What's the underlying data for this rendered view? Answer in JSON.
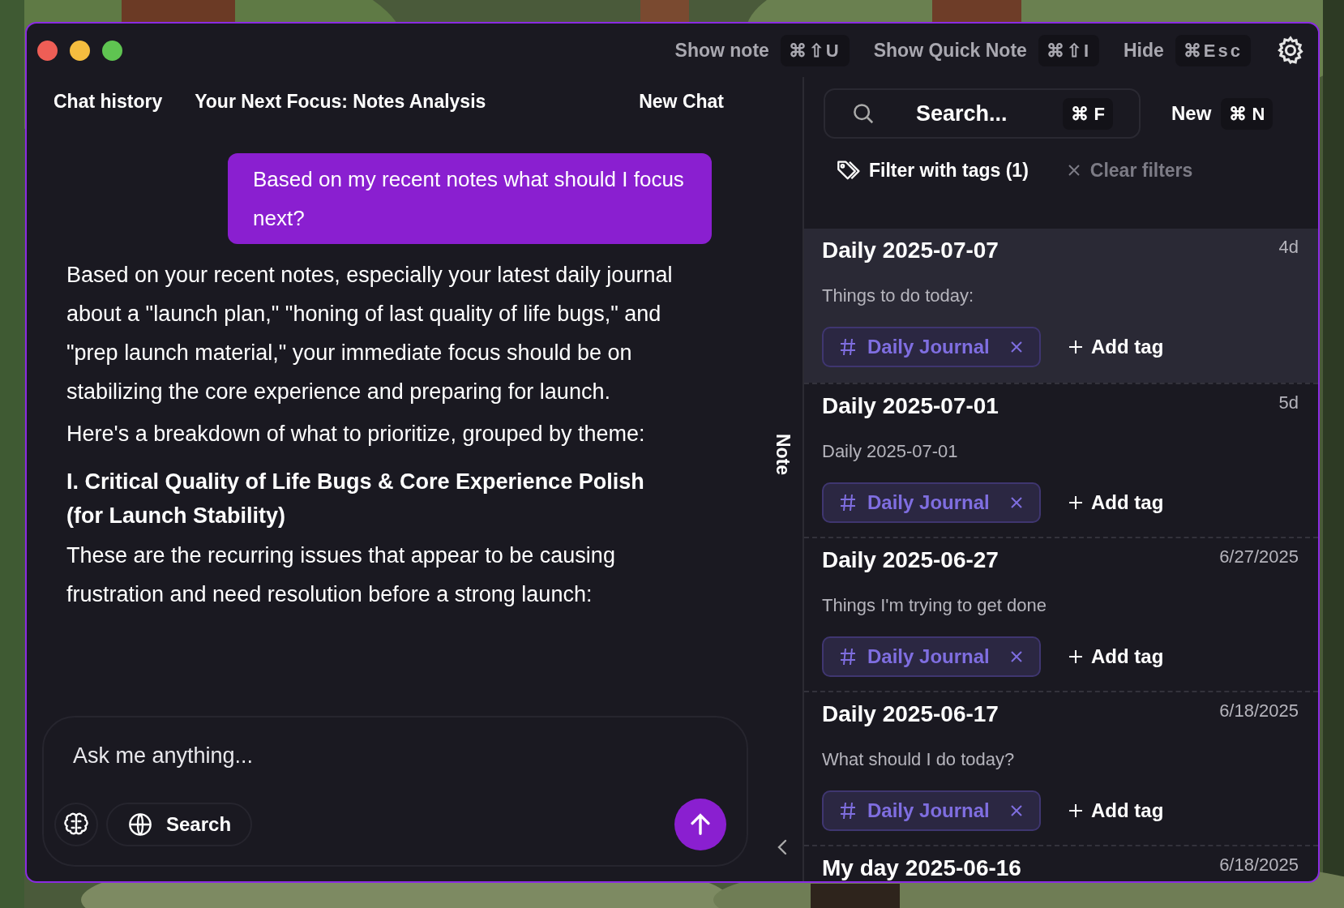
{
  "toolbar": {
    "shortcuts": [
      {
        "label": "Show note",
        "keys": "⌘⇧U"
      },
      {
        "label": "Show Quick Note",
        "keys": "⌘⇧I"
      },
      {
        "label": "Hide",
        "keys": "⌘Esc"
      }
    ]
  },
  "chat": {
    "history_label": "Chat history",
    "title": "Your Next Focus: Notes Analysis",
    "new_chat": "New Chat",
    "messages": [
      {
        "kind": "user",
        "text": "Based on my recent notes what should I focus next?"
      },
      {
        "kind": "assistant",
        "blocks": [
          {
            "kind": "paragraph",
            "text": "Based on your recent notes, especially your latest daily journal about a \"launch plan,\" \"honing of last quality of life bugs,\" and \"prep launch material,\" your immediate focus should be on stabilizing the core experience and preparing for launch."
          },
          {
            "kind": "paragraph",
            "text": "Here's a breakdown of what to prioritize, grouped by theme:"
          },
          {
            "kind": "heading",
            "text": "I. Critical Quality of Life Bugs & Core Experience Polish (for Launch Stability)"
          },
          {
            "kind": "paragraph",
            "text": "These are the recurring issues that appear to be causing frustration and need resolution before a strong launch:"
          }
        ]
      }
    ],
    "input": {
      "placeholder": "Ask me anything...",
      "search_button": "Search"
    }
  },
  "side_tab": "Note",
  "notes": {
    "search": {
      "placeholder": "Search...",
      "keys": "⌘ F"
    },
    "new_button": "New",
    "new_keys": "⌘ N",
    "filter": "Filter with tags (1)",
    "clear": "Clear filters",
    "items": [
      {
        "title": "Daily 2025-07-07",
        "time": "4d",
        "preview": "Things to do today:",
        "selected": true,
        "tags": [
          "Daily Journal"
        ],
        "add_tag": "Add tag"
      },
      {
        "title": "Daily 2025-07-01",
        "time": "5d",
        "preview": "Daily 2025-07-01",
        "selected": false,
        "tags": [
          "Daily Journal"
        ],
        "add_tag": "Add tag"
      },
      {
        "title": "Daily 2025-06-27",
        "time": "6/27/2025",
        "preview": "Things I'm trying to get done",
        "selected": false,
        "tags": [
          "Daily Journal"
        ],
        "add_tag": "Add tag"
      },
      {
        "title": "Daily 2025-06-17",
        "time": "6/18/2025",
        "preview": "What should I do today?",
        "selected": false,
        "tags": [
          "Daily Journal"
        ],
        "add_tag": "Add tag"
      },
      {
        "title": "My day 2025-06-16",
        "time": "6/18/2025",
        "selected": false
      }
    ]
  }
}
